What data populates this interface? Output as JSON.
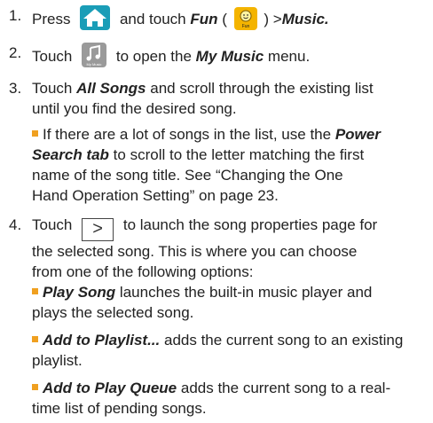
{
  "steps": {
    "s1": {
      "num": "1.",
      "pre": "Press",
      "mid": "and touch",
      "fun": "Fun",
      "paren_open": "(",
      "fun_icon_label": "Fun",
      "paren_close": ")",
      "gt": ">",
      "music": "Music."
    },
    "s2": {
      "num": "2.",
      "pre": "Touch",
      "music_icon_label": "My Music",
      "post_a": "to open the",
      "menu_name": "My Music",
      "post_b": "menu."
    },
    "s3": {
      "num": "3.",
      "pre": "Touch",
      "all_songs": "All Songs",
      "post_l1": "and scroll through the existing list",
      "line2": "until you find the desired song.",
      "sub": {
        "l1_pre": "If there are a lot of songs in the list, use the",
        "power": "Power",
        "search_tab": "Search tab",
        "l2_post": "to scroll to the letter matching the first",
        "l3": "name of the song title. See “Changing the One",
        "l4": "Hand Operation Setting” on page 23."
      }
    },
    "s4": {
      "num": "4.",
      "pre": "Touch",
      "arrow": ">",
      "post_l1": "to launch the song properties page for",
      "l2": "the selected song. This is where you can choose",
      "l3": "from one of the following options:"
    },
    "options": [
      {
        "name": "Play Song",
        "l1": "launches the built-in music player and",
        "l2": "plays the selected song."
      },
      {
        "name": "Add to Playlist...",
        "l1": "adds the current song to an existing",
        "l2": "playlist."
      },
      {
        "name": "Add to Play Queue",
        "l1": "adds the current song to a real-",
        "l2": "time list of pending songs."
      }
    ]
  },
  "colors": {
    "bullet": "#f0a020",
    "home_icon": "#1a9db7",
    "fun_icon": "#f4b400",
    "music_icon": "#9a9a9a"
  }
}
